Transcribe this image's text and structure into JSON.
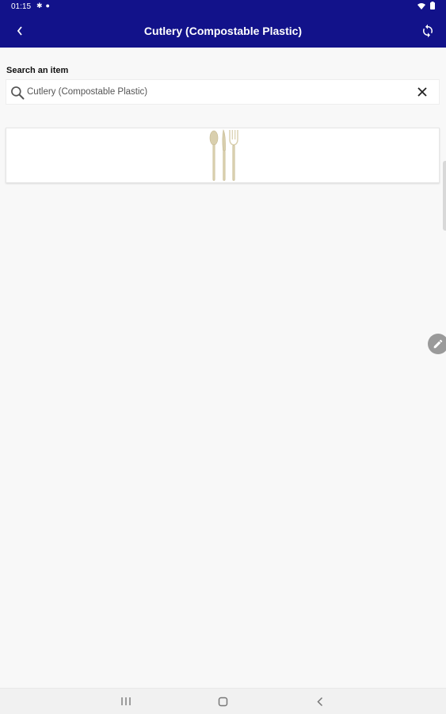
{
  "status_bar": {
    "time": "01:15",
    "left_icons": [
      "notification-icon",
      "mic-icon"
    ],
    "right_icons": [
      "wifi-icon",
      "battery-icon"
    ]
  },
  "app_bar": {
    "title": "Cutlery (Compostable Plastic)",
    "background_color": "#12128a",
    "back_icon": "chevron-left-icon",
    "action_icon": "refresh-icon"
  },
  "search": {
    "label": "Search an item",
    "value": "Cutlery (Compostable Plastic)",
    "icon": "search-icon",
    "clear_icon": "close-icon"
  },
  "results": [
    {
      "image": "cutlery-image",
      "description": "spoon, knife and fork"
    }
  ],
  "fab": {
    "icon": "pencil-icon"
  },
  "nav_bar": {
    "buttons": [
      "recent-apps-icon",
      "home-icon",
      "back-icon"
    ]
  }
}
